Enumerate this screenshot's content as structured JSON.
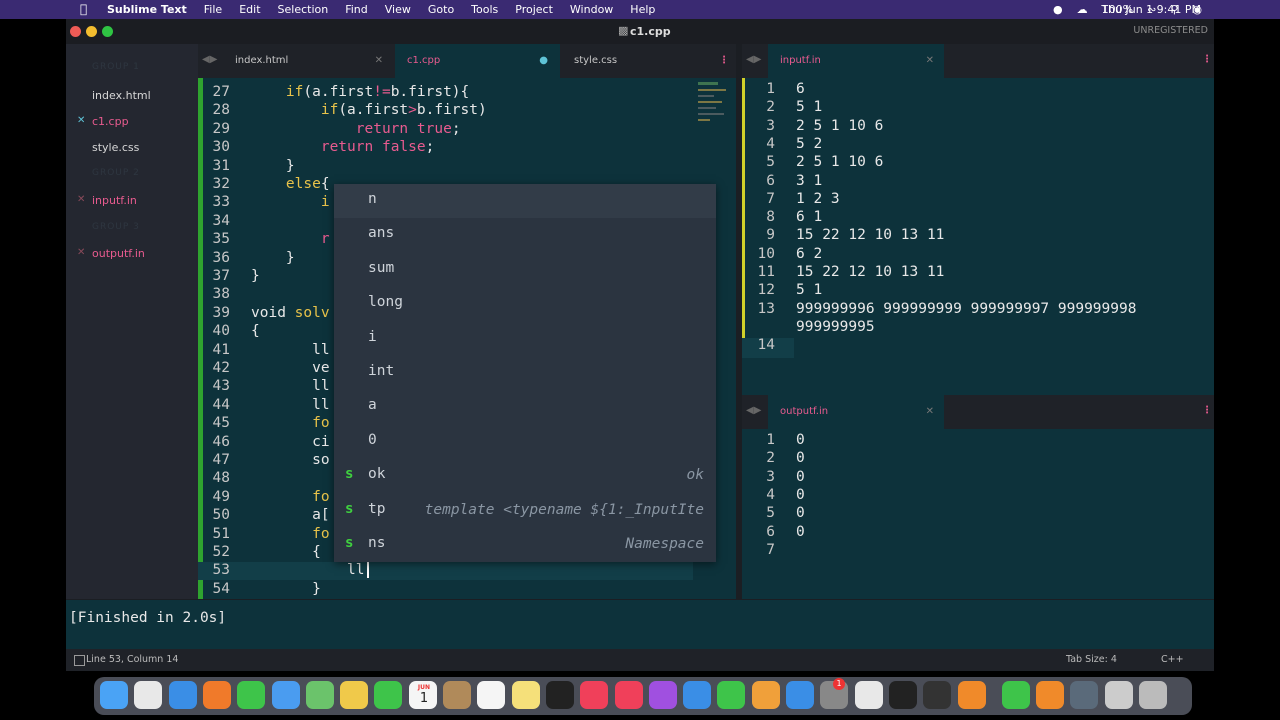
{
  "menubar": {
    "app_name": "Sublime Text",
    "menus": [
      "File",
      "Edit",
      "Selection",
      "Find",
      "View",
      "Goto",
      "Tools",
      "Project",
      "Window",
      "Help"
    ],
    "battery": "100%",
    "datetime": "Thu Jun 1  9:41 PM"
  },
  "window": {
    "title": "c1.cpp",
    "registration": "UNREGISTERED"
  },
  "sidebar": {
    "groups": [
      "GROUP 1",
      "GROUP 2",
      "GROUP 3"
    ],
    "items": [
      {
        "label": "index.html"
      },
      {
        "label": "c1.cpp"
      },
      {
        "label": "style.css"
      },
      {
        "label": "inputf.in"
      },
      {
        "label": "outputf.in"
      }
    ]
  },
  "tabs_left": [
    "index.html",
    "c1.cpp",
    "style.css"
  ],
  "tab_right_top": "inputf.in",
  "tab_right_bottom": "outputf.in",
  "editor": {
    "lines": [
      {
        "n": "27",
        "segs": [
          [
            "txt",
            "    "
          ],
          [
            "kw",
            "if"
          ],
          [
            "txt",
            "(a.first"
          ],
          [
            "pk",
            "!="
          ],
          [
            "txt",
            "b.first){"
          ]
        ]
      },
      {
        "n": "28",
        "segs": [
          [
            "txt",
            "        "
          ],
          [
            "kw",
            "if"
          ],
          [
            "txt",
            "(a.first"
          ],
          [
            "pk",
            ">"
          ],
          [
            "txt",
            "b.first)"
          ]
        ]
      },
      {
        "n": "29",
        "segs": [
          [
            "txt",
            "            "
          ],
          [
            "pk",
            "return"
          ],
          [
            "txt",
            " "
          ],
          [
            "pk",
            "true"
          ],
          [
            "txt",
            ";"
          ]
        ]
      },
      {
        "n": "30",
        "segs": [
          [
            "txt",
            "        "
          ],
          [
            "pk",
            "return"
          ],
          [
            "txt",
            " "
          ],
          [
            "pk",
            "false"
          ],
          [
            "txt",
            ";"
          ]
        ]
      },
      {
        "n": "31",
        "segs": [
          [
            "txt",
            "    }"
          ]
        ]
      },
      {
        "n": "32",
        "segs": [
          [
            "txt",
            "    "
          ],
          [
            "kw",
            "else"
          ],
          [
            "txt",
            "{"
          ]
        ]
      },
      {
        "n": "33",
        "segs": [
          [
            "txt",
            "        "
          ],
          [
            "kw",
            "i"
          ]
        ]
      },
      {
        "n": "34",
        "segs": []
      },
      {
        "n": "35",
        "segs": [
          [
            "txt",
            "        "
          ],
          [
            "pk",
            "r"
          ]
        ]
      },
      {
        "n": "36",
        "segs": [
          [
            "txt",
            "    }"
          ]
        ]
      },
      {
        "n": "37",
        "segs": [
          [
            "txt",
            "}"
          ]
        ]
      },
      {
        "n": "38",
        "segs": []
      },
      {
        "n": "39",
        "segs": [
          [
            "txt",
            "void "
          ],
          [
            "fn",
            "solv"
          ]
        ]
      },
      {
        "n": "40",
        "segs": [
          [
            "txt",
            "{"
          ]
        ]
      },
      {
        "n": "41",
        "segs": [
          [
            "txt",
            "       ll"
          ]
        ]
      },
      {
        "n": "42",
        "segs": [
          [
            "txt",
            "       ve"
          ]
        ]
      },
      {
        "n": "43",
        "segs": [
          [
            "txt",
            "       ll"
          ]
        ]
      },
      {
        "n": "44",
        "segs": [
          [
            "txt",
            "       ll"
          ]
        ]
      },
      {
        "n": "45",
        "segs": [
          [
            "txt",
            "       "
          ],
          [
            "kw",
            "fo"
          ]
        ]
      },
      {
        "n": "46",
        "segs": [
          [
            "txt",
            "       ci"
          ]
        ]
      },
      {
        "n": "47",
        "segs": [
          [
            "txt",
            "       so"
          ]
        ]
      },
      {
        "n": "48",
        "segs": []
      },
      {
        "n": "49",
        "segs": [
          [
            "txt",
            "       "
          ],
          [
            "kw",
            "fo"
          ]
        ]
      },
      {
        "n": "50",
        "segs": [
          [
            "txt",
            "       a["
          ]
        ]
      },
      {
        "n": "51",
        "segs": [
          [
            "txt",
            "       "
          ],
          [
            "kw",
            "fo"
          ]
        ]
      },
      {
        "n": "52",
        "segs": [
          [
            "txt",
            "       {"
          ]
        ]
      },
      {
        "n": "53",
        "segs": [
          [
            "txt",
            "           ll "
          ]
        ]
      },
      {
        "n": "54",
        "segs": [
          [
            "txt",
            "       }"
          ]
        ]
      }
    ]
  },
  "autocomplete": [
    {
      "label": "n",
      "snippet": false,
      "hint": ""
    },
    {
      "label": "ans",
      "snippet": false,
      "hint": ""
    },
    {
      "label": "sum",
      "snippet": false,
      "hint": ""
    },
    {
      "label": "long",
      "snippet": false,
      "hint": ""
    },
    {
      "label": "i",
      "snippet": false,
      "hint": ""
    },
    {
      "label": "int",
      "snippet": false,
      "hint": ""
    },
    {
      "label": "a",
      "snippet": false,
      "hint": ""
    },
    {
      "label": "0",
      "snippet": false,
      "hint": ""
    },
    {
      "label": "ok",
      "snippet": true,
      "hint": "ok"
    },
    {
      "label": "tp",
      "snippet": true,
      "hint": "template <typename ${1:_InputIte"
    },
    {
      "label": "ns",
      "snippet": true,
      "hint": "Namespace"
    }
  ],
  "input_lines": [
    {
      "n": "1",
      "t": "6"
    },
    {
      "n": "2",
      "t": "5 1"
    },
    {
      "n": "3",
      "t": "2 5 1 10 6"
    },
    {
      "n": "4",
      "t": "5 2"
    },
    {
      "n": "5",
      "t": "2 5 1 10 6"
    },
    {
      "n": "6",
      "t": "3 1"
    },
    {
      "n": "7",
      "t": "1 2 3"
    },
    {
      "n": "8",
      "t": "6 1"
    },
    {
      "n": "9",
      "t": "15 22 12 10 13 11"
    },
    {
      "n": "10",
      "t": "6 2"
    },
    {
      "n": "11",
      "t": "15 22 12 10 13 11"
    },
    {
      "n": "12",
      "t": "5 1"
    },
    {
      "n": "13",
      "t": "999999996 999999999 999999997 999999998"
    },
    {
      "n": "",
      "t": "999999995"
    },
    {
      "n": "14",
      "t": ""
    }
  ],
  "output_lines": [
    {
      "n": "1",
      "t": "0"
    },
    {
      "n": "2",
      "t": "0"
    },
    {
      "n": "3",
      "t": "0"
    },
    {
      "n": "4",
      "t": "0"
    },
    {
      "n": "5",
      "t": "0"
    },
    {
      "n": "6",
      "t": "0"
    },
    {
      "n": "7",
      "t": ""
    }
  ],
  "build_output": "[Finished in 2.0s]",
  "status": {
    "position": "Line 53, Column 14",
    "tab_size": "Tab Size: 4",
    "syntax": "C++"
  },
  "colors": {
    "editor_bg": "#0d323b",
    "keyword": "#e8c34a",
    "pink": "#e85b8f",
    "accent_bar": "#d1d12a",
    "menubar": "#3a2a72"
  },
  "dock_icons": [
    "finder-icon",
    "launchpad-icon",
    "safari-icon",
    "firefox-icon",
    "messages-icon",
    "mail-icon",
    "maps-icon",
    "photos-icon",
    "facetime-icon",
    "calendar-icon",
    "contacts-icon",
    "reminders-icon",
    "notes-icon",
    "appletv-icon",
    "music-icon",
    "news-icon",
    "podcasts-icon",
    "keynote-icon",
    "numbers-icon",
    "pages-icon",
    "appstore-icon",
    "systemprefs-icon",
    "chrome-icon",
    "terminal-icon",
    "console-icon",
    "vlc-icon",
    "whatsapp-icon",
    "sublime-icon",
    "quicktime-icon",
    "preview-icon",
    "trash-icon"
  ],
  "dock": {
    "calendar_month": "JUN",
    "calendar_day": "1",
    "prefs_badge": "1"
  }
}
